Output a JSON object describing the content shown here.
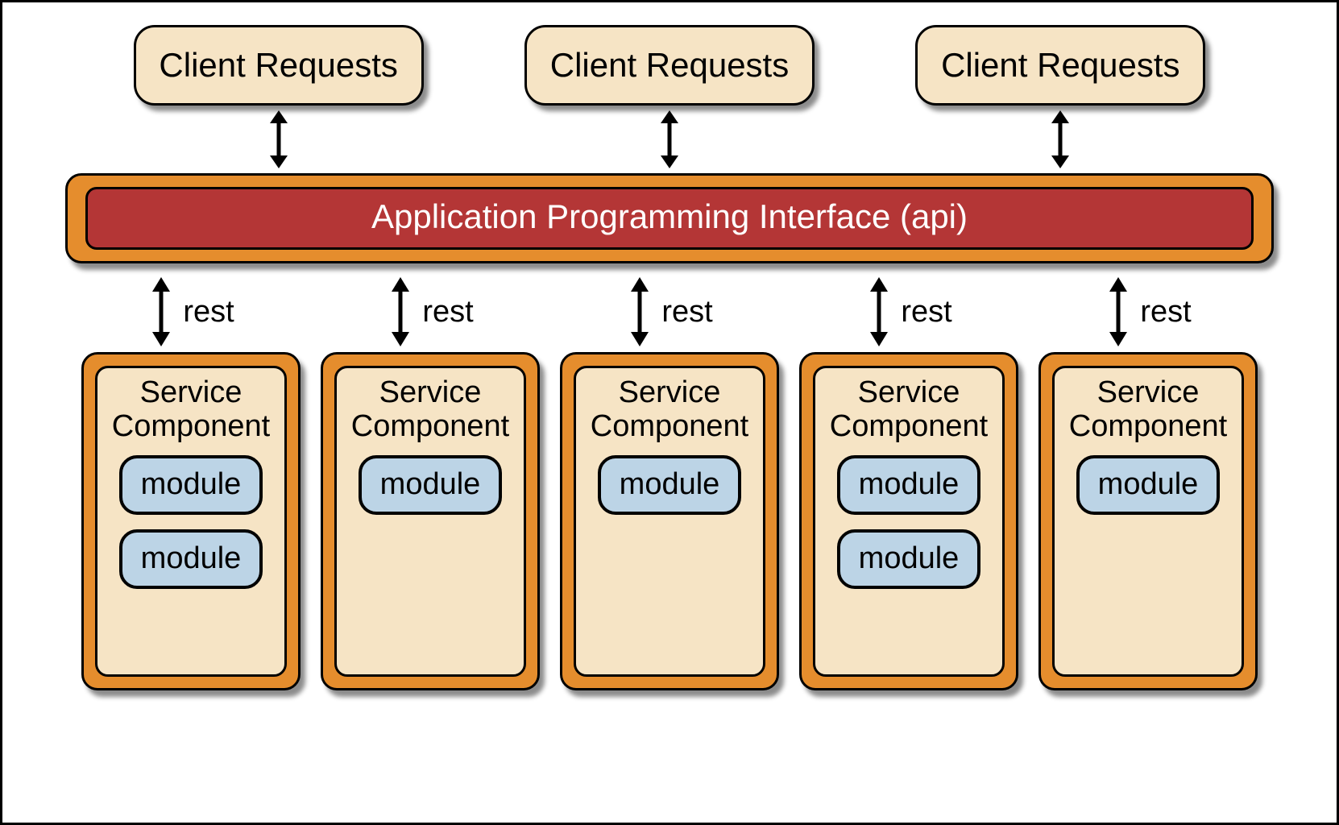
{
  "clients": [
    {
      "label": "Client Requests"
    },
    {
      "label": "Client Requests"
    },
    {
      "label": "Client Requests"
    }
  ],
  "api": {
    "label": "Application Programming Interface (api)"
  },
  "rest_connectors": [
    {
      "label": "rest"
    },
    {
      "label": "rest"
    },
    {
      "label": "rest"
    },
    {
      "label": "rest"
    },
    {
      "label": "rest"
    }
  ],
  "services": [
    {
      "title_line1": "Service",
      "title_line2": "Component",
      "modules": [
        {
          "label": "module"
        },
        {
          "label": "module"
        }
      ]
    },
    {
      "title_line1": "Service",
      "title_line2": "Component",
      "modules": [
        {
          "label": "module"
        }
      ]
    },
    {
      "title_line1": "Service",
      "title_line2": "Component",
      "modules": [
        {
          "label": "module"
        }
      ]
    },
    {
      "title_line1": "Service",
      "title_line2": "Component",
      "modules": [
        {
          "label": "module"
        },
        {
          "label": "module"
        }
      ]
    },
    {
      "title_line1": "Service",
      "title_line2": "Component",
      "modules": [
        {
          "label": "module"
        }
      ]
    }
  ]
}
